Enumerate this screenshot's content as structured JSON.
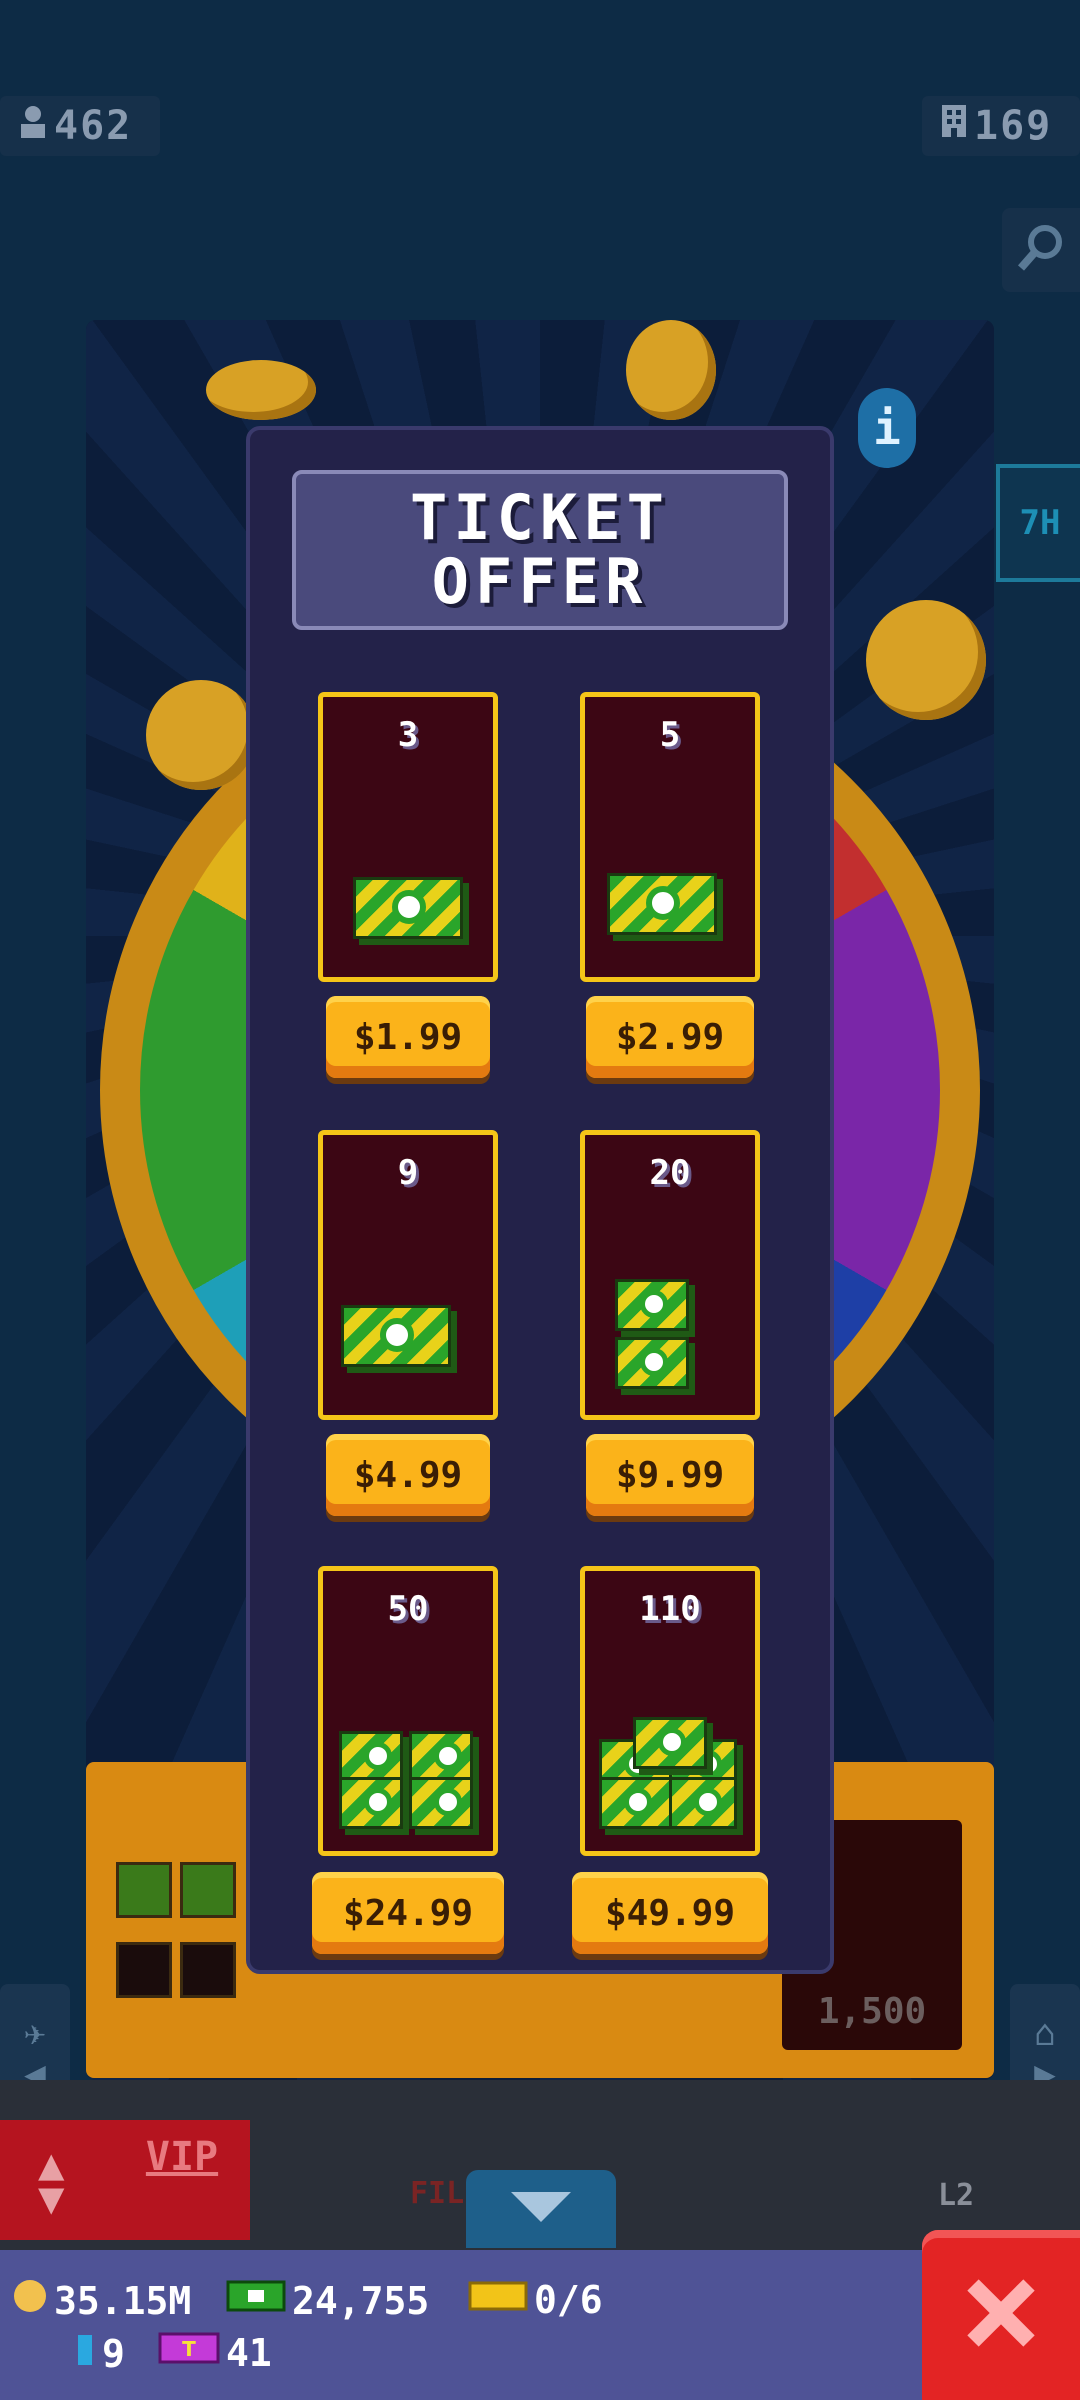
{
  "top": {
    "players": "462",
    "floors": "169"
  },
  "side_tab": "7H",
  "modal": {
    "title_line1": "TICKET",
    "title_line2": "OFFER",
    "offers": [
      {
        "count": "3",
        "price": "$1.99"
      },
      {
        "count": "5",
        "price": "$2.99"
      },
      {
        "count": "9",
        "price": "$4.99"
      },
      {
        "count": "20",
        "price": "$9.99"
      },
      {
        "count": "50",
        "price": "$24.99"
      },
      {
        "count": "110",
        "price": "$49.99"
      }
    ]
  },
  "background": {
    "reward_amount": "1,500",
    "vip_label": "VIP",
    "floor_text": "FIL",
    "level": "L2"
  },
  "status": {
    "coins": "35.15M",
    "bux": "24,755",
    "vip_tickets": "0/6",
    "keys": "9",
    "tokens": "41"
  },
  "colors": {
    "accent_gold": "#f5c518",
    "button_orange": "#fbb31a",
    "modal_bg": "#232249",
    "close_red": "#e32424"
  }
}
